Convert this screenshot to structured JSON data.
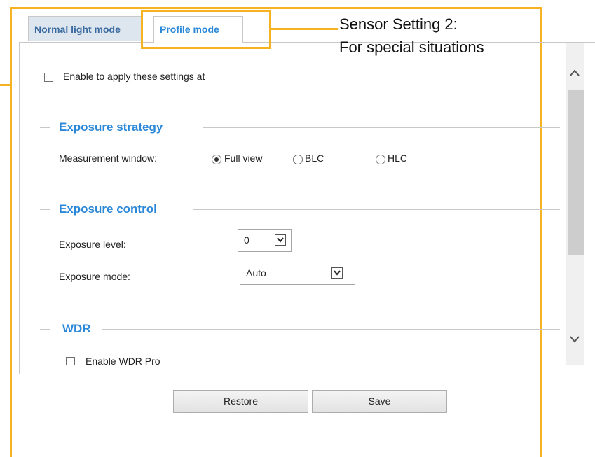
{
  "tabs": [
    {
      "label": "Normal light mode"
    },
    {
      "label": "Profile mode"
    }
  ],
  "annotation": {
    "line1": "Sensor Setting 2:",
    "line2": "For special situations",
    "color": "#f5b324"
  },
  "enable_apply": {
    "label": "Enable to apply these settings at",
    "checked": false
  },
  "exposure_strategy": {
    "title": "Exposure strategy",
    "measurement_label": "Measurement window:",
    "options": [
      "Full view",
      "BLC",
      "HLC"
    ],
    "selected": "Full view"
  },
  "exposure_control": {
    "title": "Exposure control",
    "level_label": "Exposure level:",
    "level_value": "0",
    "mode_label": "Exposure mode:",
    "mode_value": "Auto"
  },
  "wdr": {
    "title": "WDR",
    "enable_label": "Enable WDR Pro",
    "checked": false
  },
  "buttons": {
    "restore": "Restore",
    "save": "Save"
  },
  "colors": {
    "accent": "#2b88d8",
    "tab_inactive_bg": "#dde6ee",
    "annotation": "#f5b324"
  },
  "icons": [
    "chevron-up-icon",
    "chevron-down-icon",
    "dropdown-arrow-icon"
  ]
}
